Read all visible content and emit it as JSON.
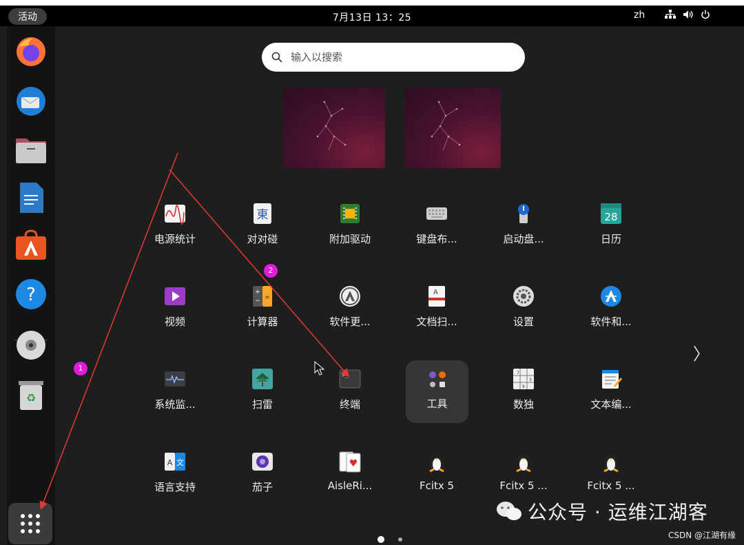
{
  "topbar": {
    "activities": "活动",
    "clock": "7月13日 13：25",
    "input_lang": "zh"
  },
  "dock": {
    "items": [
      "firefox-icon",
      "thunderbird-icon",
      "files-icon",
      "libreoffice-writer-icon",
      "app-center-icon",
      "help-icon",
      "disc-icon",
      "trash-icon"
    ]
  },
  "search": {
    "placeholder": "输入以搜索"
  },
  "apps": [
    {
      "label": "电源统计",
      "icon": "power-statistics-icon"
    },
    {
      "label": "对对碰",
      "icon": "mahjongg-icon"
    },
    {
      "label": "附加驱动",
      "icon": "additional-drivers-icon"
    },
    {
      "label": "键盘布...",
      "icon": "keyboard-layout-icon"
    },
    {
      "label": "启动盘...",
      "icon": "startup-disk-icon"
    },
    {
      "label": "日历",
      "icon": "calendar-icon"
    },
    {
      "label": "视频",
      "icon": "videos-icon"
    },
    {
      "label": "计算器",
      "icon": "calculator-icon"
    },
    {
      "label": "软件更...",
      "icon": "software-updater-icon"
    },
    {
      "label": "文档扫...",
      "icon": "document-scanner-icon"
    },
    {
      "label": "设置",
      "icon": "settings-icon"
    },
    {
      "label": "软件和...",
      "icon": "software-sources-icon"
    },
    {
      "label": "系统监...",
      "icon": "system-monitor-icon"
    },
    {
      "label": "扫雷",
      "icon": "mines-icon"
    },
    {
      "label": "终端",
      "icon": "terminal-icon"
    },
    {
      "label": "工具",
      "icon": "utilities-folder-icon"
    },
    {
      "label": "数独",
      "icon": "sudoku-icon"
    },
    {
      "label": "文本编...",
      "icon": "text-editor-icon"
    },
    {
      "label": "语言支持",
      "icon": "language-support-icon"
    },
    {
      "label": "茄子",
      "icon": "cheese-icon"
    },
    {
      "label": "AisleRi...",
      "icon": "aisleriot-icon"
    },
    {
      "label": "Fcitx 5",
      "icon": "fcitx-icon"
    },
    {
      "label": "Fcitx 5 ...",
      "icon": "fcitx-icon"
    },
    {
      "label": "Fcitx 5 ...",
      "icon": "fcitx-icon"
    }
  ],
  "annotations": {
    "badge1": "1",
    "badge2": "2"
  },
  "watermark": {
    "main": "公众号 · 运维江湖客",
    "sub": "CSDN @江湖有缘"
  },
  "colors": {
    "annotation_red": "#e53935",
    "badge_magenta": "#e01bd9",
    "selected_bg": "#363636"
  }
}
